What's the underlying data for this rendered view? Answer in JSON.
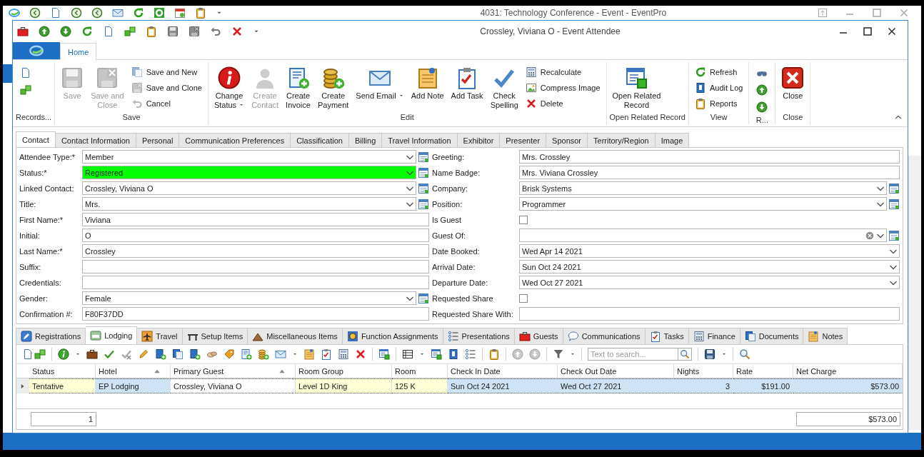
{
  "app_window": {
    "title": "4031: Technology Conference - Event - EventPro"
  },
  "window": {
    "title": "Crossley, Viviana O - Event Attendee"
  },
  "ribbon": {
    "tabs": [
      {
        "label": "Home",
        "selected": true
      }
    ],
    "groups": [
      {
        "label": "Records...",
        "items": [
          {
            "kind": "stack",
            "items": [
              {
                "kind": "icon",
                "disabled": false
              },
              {
                "kind": "icon",
                "disabled": false
              }
            ]
          }
        ]
      },
      {
        "label": "Save",
        "items": [
          {
            "kind": "large",
            "label": "Save",
            "disabled": true,
            "dropdown": false
          },
          {
            "kind": "large",
            "label": "Save and\nClose",
            "disabled": true,
            "dropdown": false
          },
          {
            "kind": "stack",
            "items": [
              {
                "kind": "small",
                "label": "Save and New",
                "disabled": true
              },
              {
                "kind": "small",
                "label": "Save and Clone",
                "disabled": true
              },
              {
                "kind": "small",
                "label": "Cancel",
                "disabled": true
              }
            ]
          }
        ]
      },
      {
        "label": "Edit",
        "items": [
          {
            "kind": "large",
            "label": "Change\nStatus",
            "disabled": false,
            "dropdown": true
          },
          {
            "kind": "large",
            "label": "Create\nContact",
            "disabled": true,
            "dropdown": false
          },
          {
            "kind": "large",
            "label": "Create\nInvoice",
            "disabled": false,
            "dropdown": false
          },
          {
            "kind": "large",
            "label": "Create\nPayment",
            "disabled": false,
            "dropdown": false
          },
          {
            "kind": "large",
            "label": "Send Email",
            "disabled": false,
            "dropdown": true
          },
          {
            "kind": "large",
            "label": "Add Note",
            "disabled": false,
            "dropdown": false
          },
          {
            "kind": "large",
            "label": "Add Task",
            "disabled": false,
            "dropdown": false
          },
          {
            "kind": "large",
            "label": "Check\nSpelling",
            "disabled": false,
            "dropdown": false
          },
          {
            "kind": "stack",
            "items": [
              {
                "kind": "small",
                "label": "Recalculate",
                "disabled": false
              },
              {
                "kind": "small",
                "label": "Compress Image",
                "disabled": false
              },
              {
                "kind": "small",
                "label": "Delete",
                "disabled": false
              }
            ]
          }
        ]
      },
      {
        "label": "Open Related Record",
        "items": [
          {
            "kind": "large",
            "label": "Open Related\nRecord",
            "disabled": false,
            "dropdown": false
          }
        ]
      },
      {
        "label": "View",
        "items": [
          {
            "kind": "stack",
            "items": [
              {
                "kind": "small",
                "label": "Refresh",
                "disabled": false
              },
              {
                "kind": "small",
                "label": "Audit Log",
                "disabled": false
              },
              {
                "kind": "small",
                "label": "Reports",
                "disabled": false
              }
            ]
          }
        ]
      },
      {
        "label": "R...",
        "items": [
          {
            "kind": "stack",
            "items": [
              {
                "kind": "icon",
                "disabled": false
              },
              {
                "kind": "icon",
                "disabled": false
              },
              {
                "kind": "icon",
                "disabled": false
              }
            ]
          }
        ]
      },
      {
        "label": "Close",
        "items": [
          {
            "kind": "large",
            "label": "Close",
            "disabled": false,
            "dropdown": false
          }
        ]
      }
    ]
  },
  "tabs": [
    {
      "label": "Contact",
      "selected": true
    },
    {
      "label": "Contact Information",
      "selected": false
    },
    {
      "label": "Personal",
      "selected": false
    },
    {
      "label": "Communication Preferences",
      "selected": false
    },
    {
      "label": "Classification",
      "selected": false
    },
    {
      "label": "Billing",
      "selected": false
    },
    {
      "label": "Travel Information",
      "selected": false
    },
    {
      "label": "Exhibitor",
      "selected": false
    },
    {
      "label": "Presenter",
      "selected": false
    },
    {
      "label": "Sponsor",
      "selected": false
    },
    {
      "label": "Territory/Region",
      "selected": false
    },
    {
      "label": "Image",
      "selected": false
    }
  ],
  "form": {
    "left": [
      {
        "label": "Attendee Type:*",
        "kind": "combo-lookup",
        "value": "Member"
      },
      {
        "label": "Status:*",
        "kind": "combo-lookup",
        "value": "Registered",
        "color": "#00ff00"
      },
      {
        "label": "Linked Contact:",
        "kind": "combo-lookup",
        "value": "Crossley, Viviana O"
      },
      {
        "label": "Title:",
        "kind": "combo-lookup",
        "value": "Mrs."
      },
      {
        "label": "First Name:*",
        "kind": "text",
        "value": "Viviana"
      },
      {
        "label": "Initial:",
        "kind": "text",
        "value": "O"
      },
      {
        "label": "Last Name:*",
        "kind": "text",
        "value": "Crossley"
      },
      {
        "label": "Suffix:",
        "kind": "text"
      },
      {
        "label": "Credentials:",
        "kind": "text"
      },
      {
        "label": "Gender:",
        "kind": "combo-lookup",
        "value": "Female"
      },
      {
        "label": "Confirmation #:",
        "kind": "text",
        "value": "F80F37DD"
      }
    ],
    "right": [
      {
        "label": "Greeting:",
        "kind": "text",
        "value": "Mrs. Crossley"
      },
      {
        "label": "Name Badge:",
        "kind": "text",
        "value": "Mrs. Viviana Crossley"
      },
      {
        "label": "Company:",
        "kind": "combo-lookup",
        "value": "Brisk Systems"
      },
      {
        "label": "Position:",
        "kind": "combo-lookup",
        "value": "Programmer"
      },
      {
        "label": "Is Guest",
        "kind": "checkbox",
        "checked": false
      },
      {
        "label": "Guest Of:",
        "kind": "combo-clear-lookup"
      },
      {
        "label": "Date Booked:",
        "kind": "combo",
        "value": "Wed Apr 14 2021"
      },
      {
        "label": "Arrival Date:",
        "kind": "combo",
        "value": "Sun Oct 24 2021"
      },
      {
        "label": "Departure Date:",
        "kind": "combo",
        "value": "Wed Oct 27 2021"
      },
      {
        "label": "Requested Share",
        "kind": "checkbox",
        "checked": false
      },
      {
        "label": "Requested Share With:",
        "kind": "text"
      }
    ]
  },
  "detail_tabs": [
    {
      "label": "Registrations",
      "selected": false
    },
    {
      "label": "Lodging",
      "selected": true
    },
    {
      "label": "Travel",
      "selected": false
    },
    {
      "label": "Setup Items",
      "selected": false
    },
    {
      "label": "Miscellaneous Items",
      "selected": false
    },
    {
      "label": "Function Assignments",
      "selected": false
    },
    {
      "label": "Presentations",
      "selected": false
    },
    {
      "label": "Guests",
      "selected": false
    },
    {
      "label": "Communications",
      "selected": false
    },
    {
      "label": "Tasks",
      "selected": false
    },
    {
      "label": "Finance",
      "selected": false
    },
    {
      "label": "Documents",
      "selected": false
    },
    {
      "label": "Notes",
      "selected": false
    }
  ],
  "search": {
    "placeholder": "Text to search..."
  },
  "table": {
    "columns": [
      {
        "label": "Status",
        "kind": "text",
        "sorted": false
      },
      {
        "label": "Hotel",
        "kind": "text",
        "sorted": true
      },
      {
        "label": "Primary Guest",
        "kind": "text",
        "sorted": true
      },
      {
        "label": "Room Group",
        "kind": "text",
        "sorted": false
      },
      {
        "label": "Room",
        "kind": "text",
        "sorted": false
      },
      {
        "label": "Check In Date",
        "kind": "text",
        "sorted": false
      },
      {
        "label": "Check Out Date",
        "kind": "text",
        "sorted": false
      },
      {
        "label": "Nights",
        "kind": "number",
        "sorted": false
      },
      {
        "label": "Rate",
        "kind": "number",
        "sorted": false
      },
      {
        "label": "Net Charge",
        "kind": "number",
        "sorted": false
      }
    ],
    "rows": [
      {
        "selected": true,
        "cells": [
          {
            "text": "Tentative",
            "color": "#ffffd6"
          },
          {
            "text": "EP Lodging",
            "color": "#cfe3f7"
          },
          {
            "text": "Crossley, Viviana O",
            "color": "#ffffff"
          },
          {
            "text": "Level 1D King",
            "color": "#ffffd6"
          },
          {
            "text": "125 K",
            "color": "#ffffd6"
          },
          {
            "text": "Sun Oct 24 2021",
            "color": "#cfe3f7"
          },
          {
            "text": "Wed Oct 27 2021",
            "color": "#cfe3f7"
          },
          {
            "text": "3",
            "color": "#cfe3f7"
          },
          {
            "text": "$191.00",
            "color": "#cfe3f7"
          },
          {
            "text": "$573.00",
            "color": "#cfe3f7"
          }
        ]
      }
    ],
    "footer": {
      "count": "1",
      "total": "$573.00"
    }
  }
}
